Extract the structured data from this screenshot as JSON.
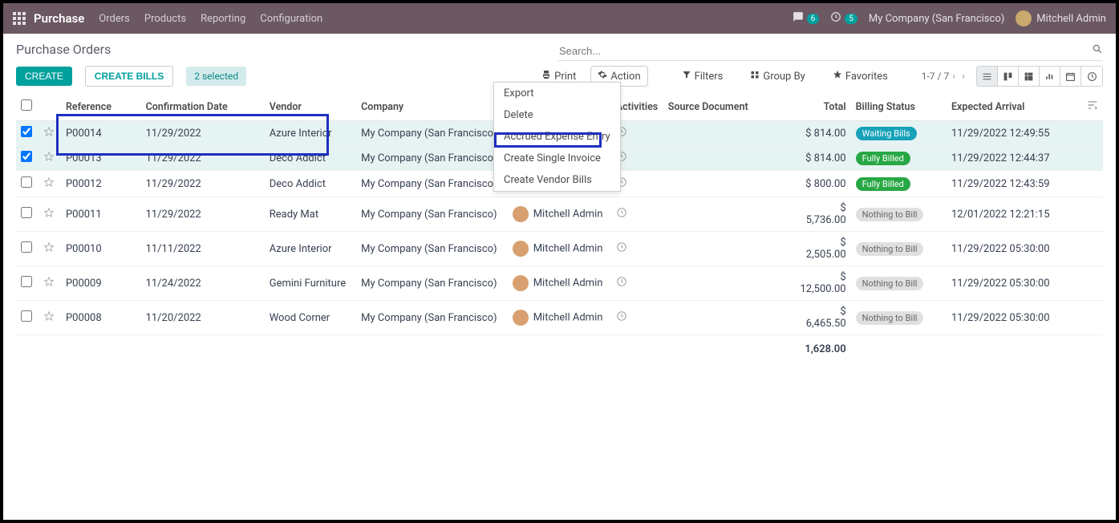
{
  "topnav": {
    "brand": "Purchase",
    "items": [
      "Orders",
      "Products",
      "Reporting",
      "Configuration"
    ],
    "chat_count": "6",
    "clock_count": "5",
    "company": "My Company (San Francisco)",
    "user": "Mitchell Admin"
  },
  "breadcrumb": {
    "title": "Purchase Orders"
  },
  "search": {
    "placeholder": "Search..."
  },
  "buttons": {
    "create": "CREATE",
    "create_bills": "CREATE BILLS",
    "selected_count": "2 selected",
    "print": "Print",
    "action": "Action",
    "filters": "Filters",
    "group_by": "Group By",
    "favorites": "Favorites"
  },
  "pager": {
    "range": "1-7 / 7"
  },
  "action_menu": {
    "items": [
      "Export",
      "Delete",
      "Accrued Expense Entry",
      "Create Single Invoice",
      "Create Vendor Bills"
    ]
  },
  "table": {
    "headers": {
      "reference": "Reference",
      "confirm_date": "Confirmation Date",
      "vendor": "Vendor",
      "company": "Company",
      "representative": "",
      "activities": "Activities",
      "source_doc": "Source Document",
      "total": "Total",
      "billing": "Billing Status",
      "arrival": "Expected Arrival"
    },
    "rows": [
      {
        "checked": true,
        "ref": "P00014",
        "date": "11/29/2022",
        "vendor": "Azure Interior",
        "company": "My Company (San Francisco)",
        "rep": "",
        "total": "$ 814.00",
        "billing": "Waiting Bills",
        "billing_cls": "badge-teal",
        "arrival": "11/29/2022 12:49:55"
      },
      {
        "checked": true,
        "ref": "P00013",
        "date": "11/29/2022",
        "vendor": "Deco Addict",
        "company": "My Company (San Francisco)",
        "rep": "",
        "total": "$ 814.00",
        "billing": "Fully Billed",
        "billing_cls": "badge-green",
        "arrival": "11/29/2022 12:44:37"
      },
      {
        "checked": false,
        "ref": "P00012",
        "date": "11/29/2022",
        "vendor": "Deco Addict",
        "company": "My Company (San Francisco)",
        "rep": "Mitchell Admin",
        "total": "$ 800.00",
        "billing": "Fully Billed",
        "billing_cls": "badge-green",
        "arrival": "11/29/2022 12:43:59"
      },
      {
        "checked": false,
        "ref": "P00011",
        "date": "11/29/2022",
        "vendor": "Ready Mat",
        "company": "My Company (San Francisco)",
        "rep": "Mitchell Admin",
        "total": "$ 5,736.00",
        "billing": "Nothing to Bill",
        "billing_cls": "badge-gray",
        "arrival": "12/01/2022 12:21:15"
      },
      {
        "checked": false,
        "ref": "P00010",
        "date": "11/11/2022",
        "vendor": "Azure Interior",
        "company": "My Company (San Francisco)",
        "rep": "Mitchell Admin",
        "total": "$ 2,505.00",
        "billing": "Nothing to Bill",
        "billing_cls": "badge-gray",
        "arrival": "11/29/2022 05:30:00"
      },
      {
        "checked": false,
        "ref": "P00009",
        "date": "11/24/2022",
        "vendor": "Gemini Furniture",
        "company": "My Company (San Francisco)",
        "rep": "Mitchell Admin",
        "total": "$ 12,500.00",
        "billing": "Nothing to Bill",
        "billing_cls": "badge-gray",
        "arrival": "11/29/2022 05:30:00"
      },
      {
        "checked": false,
        "ref": "P00008",
        "date": "11/20/2022",
        "vendor": "Wood Corner",
        "company": "My Company (San Francisco)",
        "rep": "Mitchell Admin",
        "total": "$ 6,465.50",
        "billing": "Nothing to Bill",
        "billing_cls": "badge-gray",
        "arrival": "11/29/2022 05:30:00"
      }
    ],
    "footer_total": "1,628.00"
  }
}
